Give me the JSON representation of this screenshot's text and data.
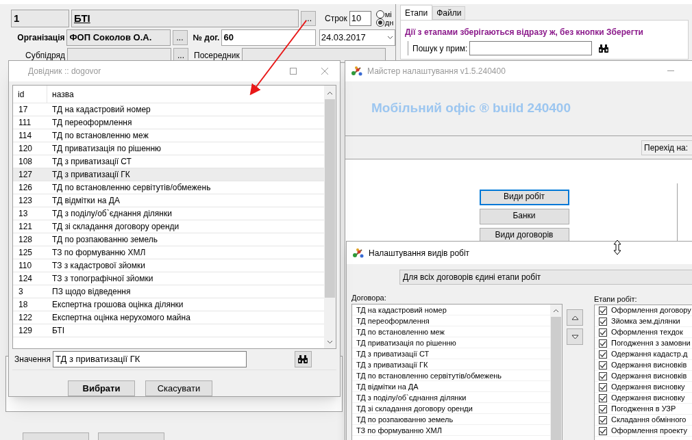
{
  "main_form": {
    "number": "1",
    "name": "БТІ",
    "name_button": "...",
    "term_label": "Строк",
    "term": "10",
    "radios": [
      {
        "label": "мі",
        "selected": false
      },
      {
        "label": "дн",
        "selected": true
      }
    ],
    "org_label": "Організація",
    "org_value": "ФОП Соколов О.А.",
    "org_button": "...",
    "contract_label": "№ дог.",
    "contract_value": "60",
    "date": "24.03.2017",
    "sub_label": "Субпідряд",
    "sub_button": "...",
    "mediator_label": "Посередник"
  },
  "side_panel": {
    "tabs": [
      {
        "label": "Етапи",
        "selected": true
      },
      {
        "label": "Файли",
        "selected": false
      }
    ],
    "notice": "Дії з етапами зберігаються відразу ж, без кнопки Зберегти",
    "search_label": "Пошук у прим:"
  },
  "wizard": {
    "title": "Майстер налаштування v1.5.240400",
    "product": "Мобільний офіс ® build 240400",
    "jump_label": "Перехід на:",
    "buttons": [
      {
        "label": "Види робіт",
        "focused": true
      },
      {
        "label": "Банки",
        "focused": false
      },
      {
        "label": "Види договорів",
        "focused": false
      }
    ]
  },
  "work_types": {
    "title": "Налаштування видів робіт",
    "mode": "Для всіх договорів єдині етапи робіт",
    "contracts_label": "Договора:",
    "contracts": [
      "ТД на кадастровий номер",
      "ТД переоформлення",
      "ТД по встановленню меж",
      "ТД приватизація по рішенню",
      "ТД з приватизації СТ",
      "ТД з приватизації ГК",
      "ТД по встановленню сервітутів/обмежень",
      "ТД відмітки на ДА",
      "ТД з поділу/об`єднання ділянки",
      "ТД зі складання договору оренди",
      "ТД по розпаюванню земель",
      "ТЗ по формуванню ХМЛ"
    ],
    "stages_label": "Етапи робіт:",
    "stages": [
      {
        "label": "Оформлення договору",
        "checked": true
      },
      {
        "label": "Зйомка зем.ділянки",
        "checked": true
      },
      {
        "label": "Оформлення техдок",
        "checked": true
      },
      {
        "label": "Погодження з замовни",
        "checked": true
      },
      {
        "label": "Одержання кадастр.д",
        "checked": true
      },
      {
        "label": "Одержання висновків",
        "checked": true
      },
      {
        "label": "Одержання висновків",
        "checked": true
      },
      {
        "label": "Одержання висновку",
        "checked": true
      },
      {
        "label": "Одержання висновку",
        "checked": true
      },
      {
        "label": "Погодження в УЗР",
        "checked": true
      },
      {
        "label": "Складання обмінного",
        "checked": true
      },
      {
        "label": "Оформлення проекту",
        "checked": true
      }
    ]
  },
  "reference_dialog": {
    "title": "Довідник :: dogovor",
    "columns": [
      "id",
      "назва"
    ],
    "rows": [
      {
        "id": "17",
        "name": "ТД на кадастровий номер",
        "selected": false
      },
      {
        "id": "111",
        "name": "ТД переоформлення",
        "selected": false
      },
      {
        "id": "114",
        "name": "ТД по встановленню меж",
        "selected": false
      },
      {
        "id": "120",
        "name": "ТД приватизація по рішенню",
        "selected": false
      },
      {
        "id": "108",
        "name": "ТД з приватизації СТ",
        "selected": false
      },
      {
        "id": "127",
        "name": "ТД з приватизації ГК",
        "selected": true
      },
      {
        "id": "126",
        "name": "ТД по встановленню сервітутів/обмежень",
        "selected": false
      },
      {
        "id": "123",
        "name": "ТД відмітки на ДА",
        "selected": false
      },
      {
        "id": "13",
        "name": "ТД з поділу/об`єднання ділянки",
        "selected": false
      },
      {
        "id": "121",
        "name": "ТД зі складання договору оренди",
        "selected": false
      },
      {
        "id": "128",
        "name": "ТД по розпаюванню земель",
        "selected": false
      },
      {
        "id": "125",
        "name": "ТЗ по формуванню ХМЛ",
        "selected": false
      },
      {
        "id": "110",
        "name": "ТЗ з кадастрової зйомки",
        "selected": false
      },
      {
        "id": "124",
        "name": "ТЗ з топографічної зйомки",
        "selected": false
      },
      {
        "id": "3",
        "name": "ПЗ щодо відведення",
        "selected": false
      },
      {
        "id": "18",
        "name": "Експертна грошова оцінка ділянки",
        "selected": false
      },
      {
        "id": "122",
        "name": "Експертна оцінка нерухомого майна",
        "selected": false
      },
      {
        "id": "129",
        "name": "БТІ",
        "selected": false
      }
    ],
    "value_label": "Значення",
    "value": "ТД з приватизації ГК",
    "buttons": [
      {
        "label": "Вибрати",
        "kind": "primary"
      },
      {
        "label": "Скасувати",
        "kind": "default"
      }
    ]
  }
}
